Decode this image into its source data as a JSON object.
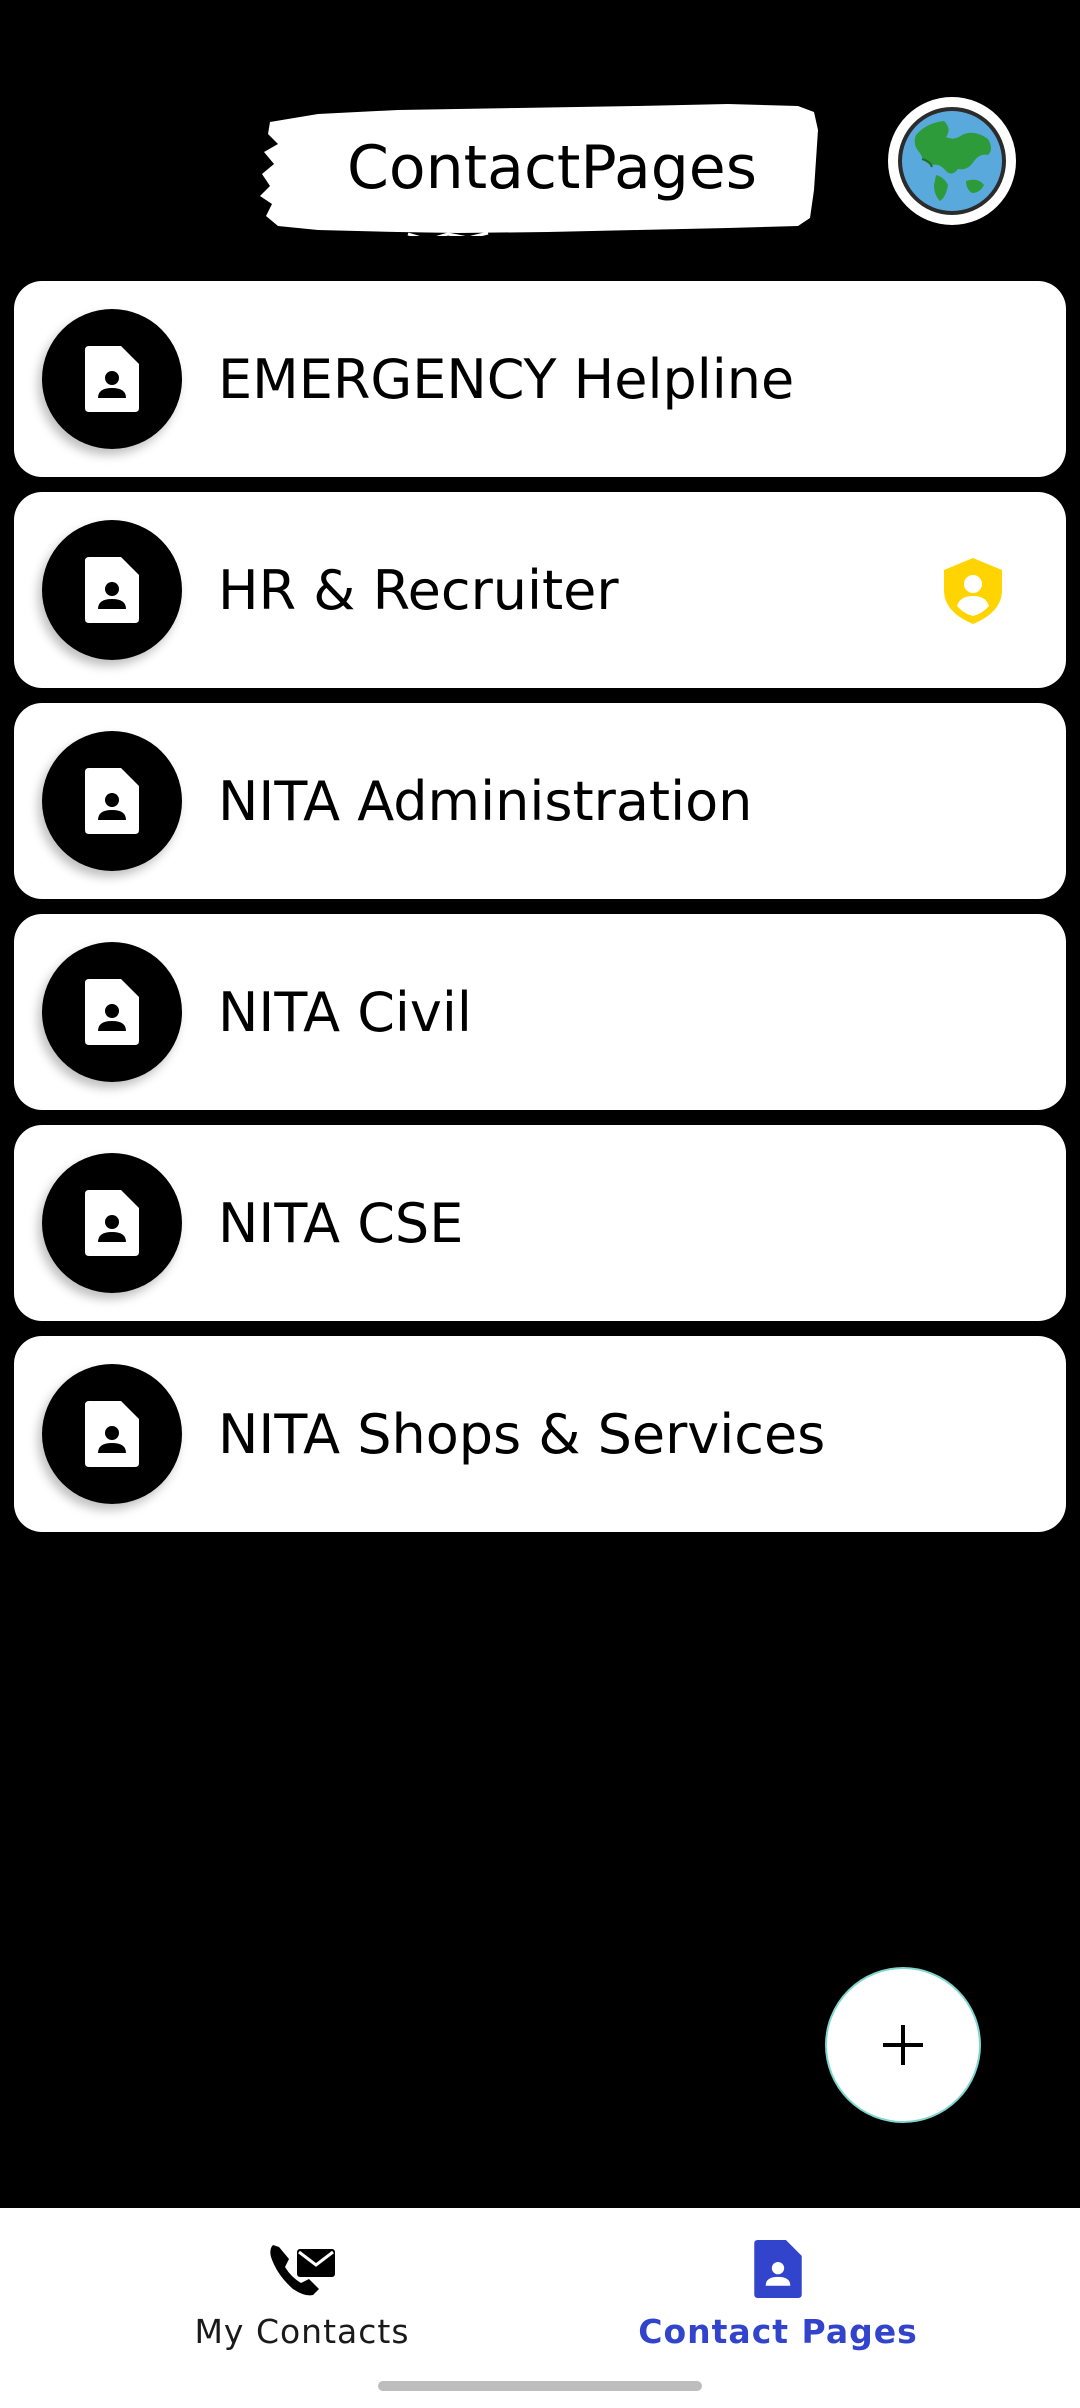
{
  "header": {
    "title": "ContactPages",
    "globe_icon": "globe-icon"
  },
  "pages": [
    {
      "label": "EMERGENCY Helpline",
      "icon": "contact-page-icon",
      "verified": false
    },
    {
      "label": "HR & Recruiter",
      "icon": "contact-page-icon",
      "verified": true
    },
    {
      "label": "NITA Administration",
      "icon": "contact-page-icon",
      "verified": false
    },
    {
      "label": "NITA Civil",
      "icon": "contact-page-icon",
      "verified": false
    },
    {
      "label": "NITA CSE",
      "icon": "contact-page-icon",
      "verified": false
    },
    {
      "label": "NITA Shops & Services",
      "icon": "contact-page-icon",
      "verified": false
    }
  ],
  "fab": {
    "icon": "plus-icon"
  },
  "bottom_nav": {
    "items": [
      {
        "label": "My Contacts",
        "icon": "phone-mail-icon",
        "active": false
      },
      {
        "label": "Contact Pages",
        "icon": "contact-page-icon",
        "active": true
      }
    ]
  },
  "colors": {
    "background": "#000000",
    "card": "#ffffff",
    "accent": "#3344cc",
    "badge": "#ffd400"
  }
}
